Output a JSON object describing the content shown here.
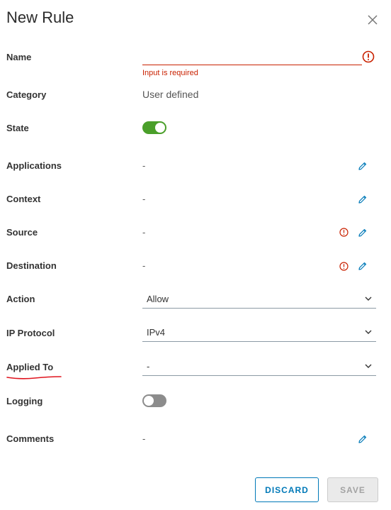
{
  "dialog": {
    "title": "New Rule"
  },
  "fields": {
    "name": {
      "label": "Name",
      "value": "",
      "error": "Input is required"
    },
    "category": {
      "label": "Category",
      "value": "User defined"
    },
    "state": {
      "label": "State",
      "enabled": true
    },
    "applications": {
      "label": "Applications",
      "value": "-"
    },
    "context": {
      "label": "Context",
      "value": "-"
    },
    "source": {
      "label": "Source",
      "value": "-"
    },
    "destination": {
      "label": "Destination",
      "value": "-"
    },
    "action": {
      "label": "Action",
      "value": "Allow"
    },
    "ip_protocol": {
      "label": "IP Protocol",
      "value": "IPv4"
    },
    "applied_to": {
      "label": "Applied To",
      "value": "-"
    },
    "logging": {
      "label": "Logging",
      "enabled": false
    },
    "comments": {
      "label": "Comments",
      "value": "-"
    }
  },
  "buttons": {
    "discard": "DISCARD",
    "save": "SAVE"
  },
  "icons": {
    "close": "close-icon",
    "error": "error-circle-icon",
    "edit": "pencil-icon",
    "warning": "warning-circle-icon",
    "dropdown": "chevron-down-icon"
  },
  "colors": {
    "error": "#c92100",
    "toggle_on": "#4a9f2a",
    "toggle_off": "#8c8c8c",
    "accent": "#0079b8",
    "annotation": "#e0141e"
  }
}
